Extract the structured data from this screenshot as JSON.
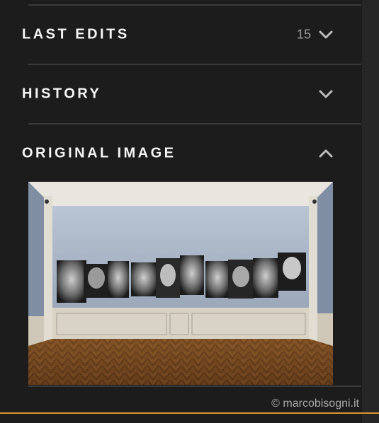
{
  "sections": [
    {
      "title": "LAST EDITS",
      "count": "15",
      "expanded": false,
      "icon": "chevron-down-icon"
    },
    {
      "title": "HISTORY",
      "expanded": false,
      "icon": "chevron-down-icon"
    },
    {
      "title": "ORIGINAL IMAGE",
      "expanded": true,
      "icon": "chevron-up-icon"
    }
  ],
  "original_image": {
    "description_icon": "gallery-photo"
  },
  "credit": "© marcobisogni.it",
  "colors": {
    "background": "#1c1c1c",
    "divider": "#3a3a3a",
    "accent": "#d9962a",
    "title": "#f5f5f5",
    "muted": "#9a9a9a"
  }
}
